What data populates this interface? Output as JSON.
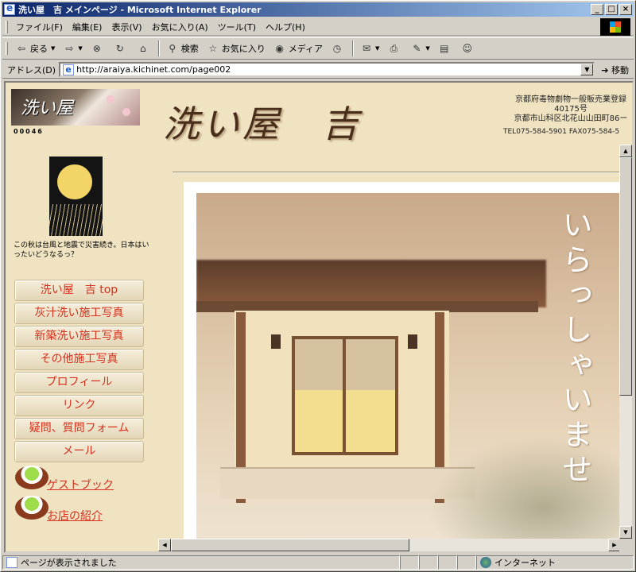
{
  "window": {
    "title": "洗い屋　吉 メインページ - Microsoft Internet Explorer",
    "controls": [
      "_",
      "□",
      "×"
    ]
  },
  "menu": [
    "ファイル(F)",
    "編集(E)",
    "表示(V)",
    "お気に入り(A)",
    "ツール(T)",
    "ヘルプ(H)"
  ],
  "toolbar": {
    "back": "戻る",
    "search": "検索",
    "favorites": "お気に入り",
    "media": "メディア"
  },
  "address": {
    "label": "アドレス(D)",
    "url": "http://araiya.kichinet.com/page002",
    "go": "移動"
  },
  "page": {
    "counter": "00046",
    "logo_text": "洗い屋",
    "notice": "この秋は台風と地震で災害続き。日本はいったいどうなるっ？",
    "site_title": "洗い屋　吉",
    "header_info": {
      "line1": "京都府毒物劇物一般販売業登録",
      "line2": "40175号",
      "line3": "京都市山科区北花山山田町86ー",
      "tel": "TEL075-584-5901 FAX075-584-5"
    },
    "nav": [
      "洗い屋　吉 top",
      "灰汁洗い施工写真",
      "新築洗い施工写真",
      "その他施工写真",
      "プロフィール",
      "リンク",
      "疑問、質問フォーム",
      "メール"
    ],
    "links": [
      "ゲストブック",
      "お店の紹介"
    ],
    "welcome": "いらっしゃいませ"
  },
  "status": {
    "message": "ページが表示されました",
    "zone": "インターネット"
  },
  "colors": {
    "title_gradient_start": "#0a246a",
    "link_red": "#d6311e",
    "page_bg": "#efe3c2"
  }
}
